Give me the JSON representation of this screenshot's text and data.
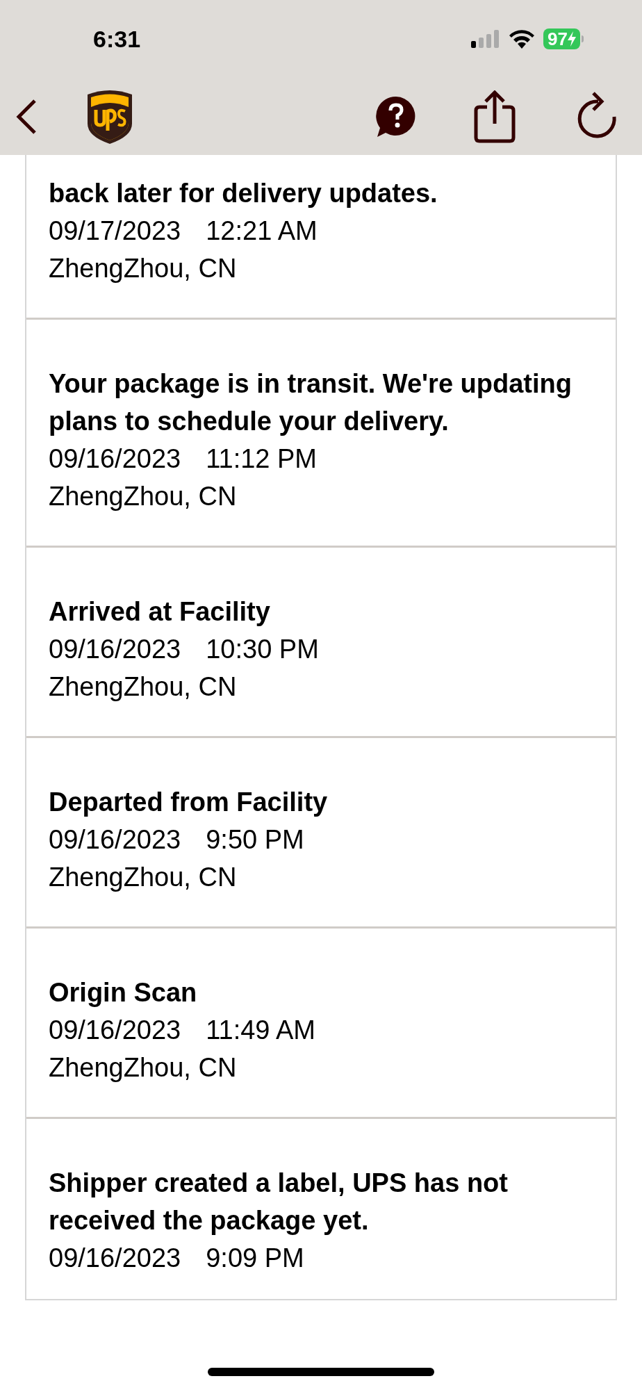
{
  "status_bar": {
    "time": "6:31",
    "battery": "97"
  },
  "events": [
    {
      "title": "back later for delivery updates.",
      "date": "09/17/2023",
      "time": "12:21 AM",
      "location": "ZhengZhou, CN"
    },
    {
      "title": "Your package is in transit. We're updating plans to schedule your delivery.",
      "date": "09/16/2023",
      "time": "11:12 PM",
      "location": "ZhengZhou, CN"
    },
    {
      "title": "Arrived at Facility",
      "date": "09/16/2023",
      "time": "10:30 PM",
      "location": "ZhengZhou, CN"
    },
    {
      "title": "Departed from Facility",
      "date": "09/16/2023",
      "time": "9:50 PM",
      "location": "ZhengZhou, CN"
    },
    {
      "title": "Origin Scan",
      "date": "09/16/2023",
      "time": "11:49 AM",
      "location": "ZhengZhou, CN"
    },
    {
      "title": "Shipper created a label, UPS has not received the package yet.",
      "date": "09/16/2023",
      "time": "9:09 PM"
    }
  ]
}
